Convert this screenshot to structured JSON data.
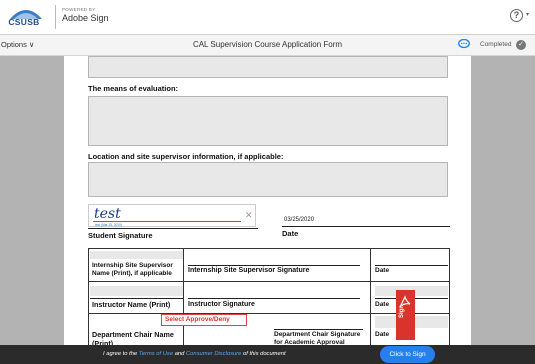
{
  "header": {
    "logo_text": "CSUSB",
    "powered_by": "POWERED BY",
    "brand": "Adobe Sign",
    "help_symbol": "?"
  },
  "toolbar": {
    "options_label": "Options ∨",
    "document_title": "CAL Supervision Course Application Form",
    "status_label": "Completed",
    "status_color": "#777777"
  },
  "document": {
    "evaluation_label": "The means of evaluation:",
    "location_label": "Location and site supervisor information, if applicable:",
    "signature_text": "test",
    "signature_caption": "test  (Mar 25, 2020)",
    "signed_date": "03/25/2020",
    "student_signature_label": "Student Signature",
    "date_label": "Date",
    "table": {
      "row1": {
        "name_label": "Internship Site Supervisor Name (Print), if applicable",
        "signature_label": "Internship Site Supervisor Signature",
        "date_label": "Date"
      },
      "row2": {
        "name_label": "Instructor Name (Print)",
        "signature_label": "Instructor Signature",
        "date_label": "Date"
      },
      "row3": {
        "name_label": "Department Chair Name (Print)",
        "approve_select": "Select Approve/Deny",
        "signature_label": "Department Chair Signature for Academic Approval",
        "date_label": "Date"
      }
    }
  },
  "sign_flag": {
    "label": "Sign",
    "color": "#d9342b"
  },
  "footer": {
    "agree_prefix": "I agree to the",
    "terms_link": "Terms of Use",
    "and_text": "and",
    "disclosure_link": "Consumer Disclosure",
    "suffix": "of this document",
    "click_to_sign": "Click to Sign",
    "button_color": "#2680eb"
  }
}
